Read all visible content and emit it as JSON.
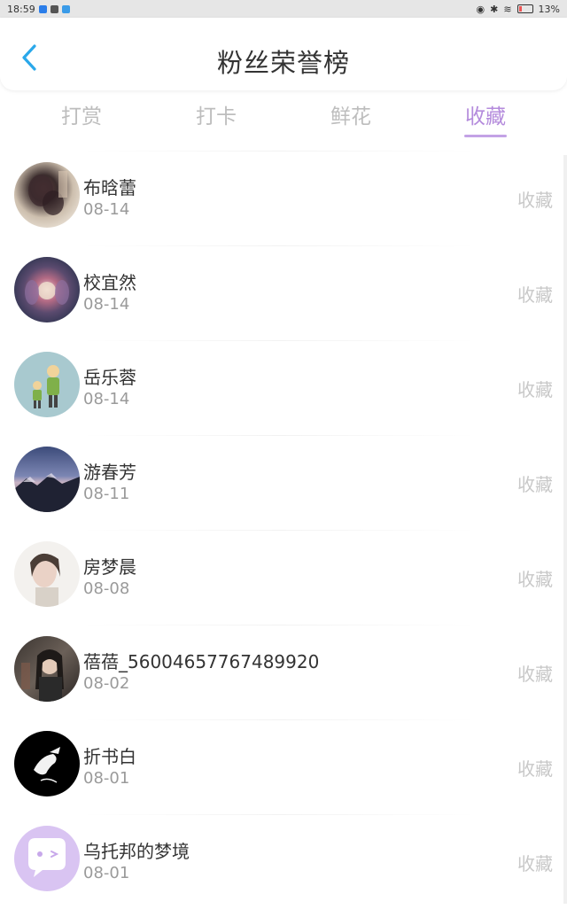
{
  "status": {
    "time": "18:59",
    "battery": "13%"
  },
  "header": {
    "title": "粉丝荣誉榜"
  },
  "tabs": [
    {
      "label": "打赏"
    },
    {
      "label": "打卡"
    },
    {
      "label": "鲜花"
    },
    {
      "label": "收藏"
    }
  ],
  "colors": {
    "accent": "#b48bdc",
    "back_icon": "#2aa8ea"
  },
  "list": [
    {
      "name": "布晗蕾",
      "date": "08-14",
      "action": "收藏"
    },
    {
      "name": "校宜然",
      "date": "08-14",
      "action": "收藏"
    },
    {
      "name": "岳乐蓉",
      "date": "08-14",
      "action": "收藏"
    },
    {
      "name": "游春芳",
      "date": "08-11",
      "action": "收藏"
    },
    {
      "name": "房梦晨",
      "date": "08-08",
      "action": "收藏"
    },
    {
      "name": "蓓蓓_56004657767489920",
      "date": "08-02",
      "action": "收藏"
    },
    {
      "name": "折书白",
      "date": "08-01",
      "action": "收藏"
    },
    {
      "name": "乌托邦的梦境",
      "date": "08-01",
      "action": "收藏"
    }
  ]
}
